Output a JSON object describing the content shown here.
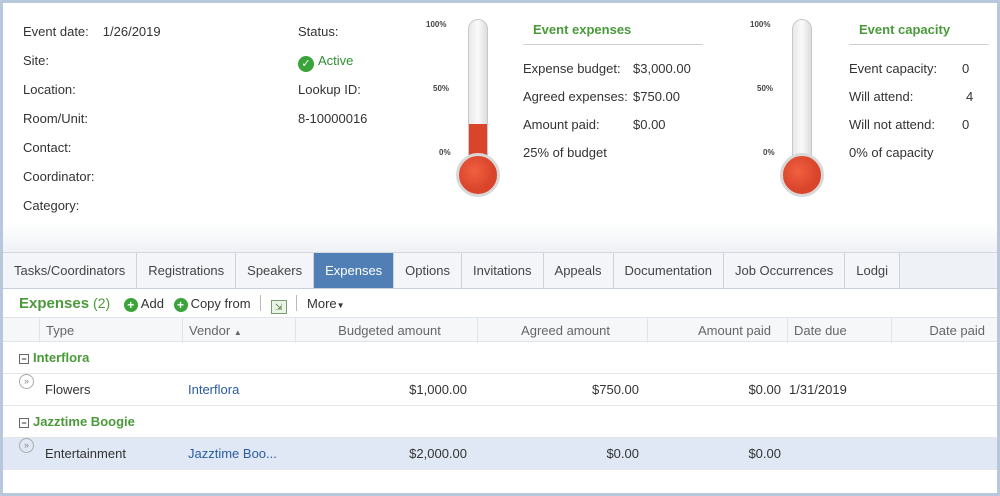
{
  "summary": {
    "event_date_label": "Event date:",
    "event_date_value": "1/26/2019",
    "site_label": "Site:",
    "location_label": "Location:",
    "room_label": "Room/Unit:",
    "contact_label": "Contact:",
    "coordinator_label": "Coordinator:",
    "category_label": "Category:",
    "status_label": "Status:",
    "status_value": "Active",
    "lookup_label": "Lookup ID:",
    "lookup_value": "8-10000016"
  },
  "thermometer_scale": {
    "top": "100%",
    "mid": "50%",
    "bottom": "0%"
  },
  "expenses_box": {
    "title": "Event expenses",
    "budget_label": "Expense budget:",
    "budget_value": "$3,000.00",
    "agreed_label": "Agreed expenses:",
    "agreed_value": "$750.00",
    "paid_label": "Amount paid:",
    "paid_value": "$0.00",
    "pct_text": "25% of budget",
    "fill_fraction": 0.25
  },
  "capacity_box": {
    "title": "Event capacity",
    "capacity_label": "Event capacity:",
    "capacity_value": "0",
    "attend_label": "Will attend:",
    "attend_value": "4",
    "notattend_label": "Will not attend:",
    "notattend_value": "0",
    "pct_text": "0% of capacity",
    "fill_fraction": 0.0
  },
  "tabs": [
    "Tasks/Coordinators",
    "Registrations",
    "Speakers",
    "Expenses",
    "Options",
    "Invitations",
    "Appeals",
    "Documentation",
    "Job Occurrences",
    "Lodgi"
  ],
  "selected_tab": "Expenses",
  "grid": {
    "title": "Expenses",
    "count": "(2)",
    "add_label": "Add",
    "copy_label": "Copy from",
    "more_label": "More",
    "columns": {
      "type": "Type",
      "vendor": "Vendor",
      "budgeted": "Budgeted amount",
      "agreed": "Agreed amount",
      "paid": "Amount paid",
      "due": "Date due",
      "datepaid": "Date paid"
    },
    "groups": [
      {
        "name": "Interflora",
        "rows": [
          {
            "type": "Flowers",
            "vendor": "Interflora",
            "budgeted": "$1,000.00",
            "agreed": "$750.00",
            "paid": "$0.00",
            "due": "1/31/2019",
            "datepaid": ""
          }
        ]
      },
      {
        "name": "Jazztime Boogie",
        "rows": [
          {
            "type": "Entertainment",
            "vendor": "Jazztime Boo...",
            "budgeted": "$2,000.00",
            "agreed": "$0.00",
            "paid": "$0.00",
            "due": "",
            "datepaid": ""
          }
        ]
      }
    ]
  }
}
